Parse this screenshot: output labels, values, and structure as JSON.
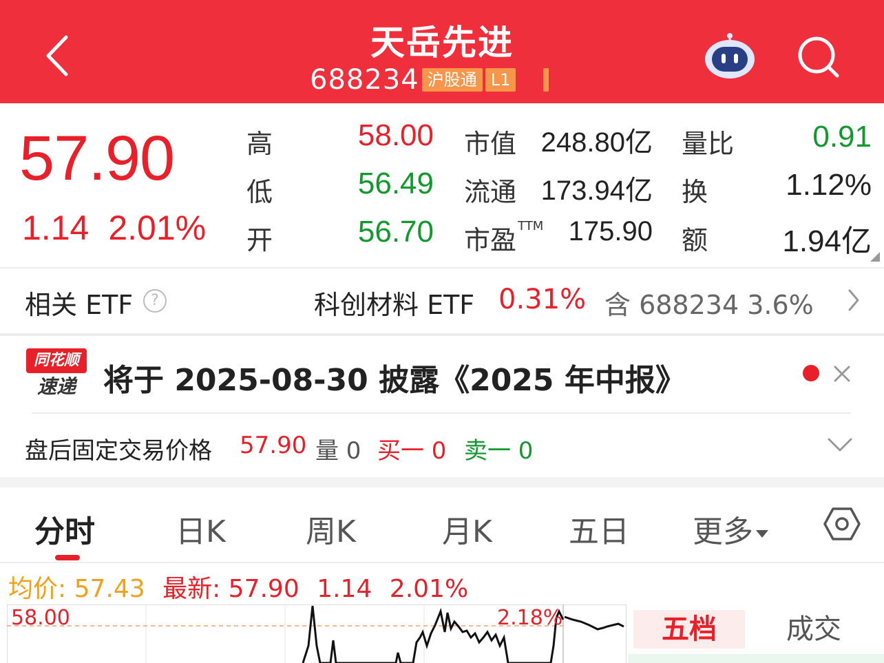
{
  "header": {
    "title": "天岳先进",
    "code": "688234",
    "tags": [
      "沪股通",
      "L1"
    ]
  },
  "quote": {
    "price": "57.90",
    "change": "1.14",
    "change_pct": "2.01%",
    "fields": [
      {
        "label": "高",
        "value": "58.00"
      },
      {
        "label": "低",
        "value": "56.49"
      },
      {
        "label": "开",
        "value": "56.70"
      },
      {
        "label": "市值",
        "value": "248.80亿"
      },
      {
        "label": "流通",
        "value": "173.94亿"
      },
      {
        "label": "市盈",
        "sup": "TTM",
        "value": "175.90"
      },
      {
        "label": "量比",
        "value": "0.91"
      },
      {
        "label": "换",
        "value": "1.12%"
      },
      {
        "label": "额",
        "value": "1.94亿"
      }
    ]
  },
  "etf": {
    "label": "相关 ETF",
    "help": "?",
    "name": "科创材料 ETF",
    "pct": "0.31%",
    "weight": "含 688234  3.6%"
  },
  "news": {
    "logo_top": "同花顺",
    "logo_bottom": "速递",
    "text": "将于 2025-08-30 披露《2025 年中报》"
  },
  "after_hours": {
    "label": "盘后固定交易价格",
    "price": "57.90",
    "volume": "量 0",
    "buy": "买一 0",
    "sell": "卖一 0"
  },
  "tabs": [
    "分时",
    "日K",
    "周K",
    "月K",
    "五日",
    "更多"
  ],
  "indicator": {
    "avg": "均价: 57.43",
    "latest": "最新: 57.90",
    "change": "1.14",
    "change_pct": "2.01%"
  },
  "chart_data": {
    "type": "line",
    "y_top_label": "58.00",
    "pct_top_label": "2.18%"
  },
  "side_panel": {
    "tabs": [
      "五档",
      "成交"
    ]
  },
  "colors": {
    "header_bg": "#ef2f3c",
    "up": "#e8202a",
    "down": "#12992e",
    "avg_line": "#f0a01e"
  }
}
